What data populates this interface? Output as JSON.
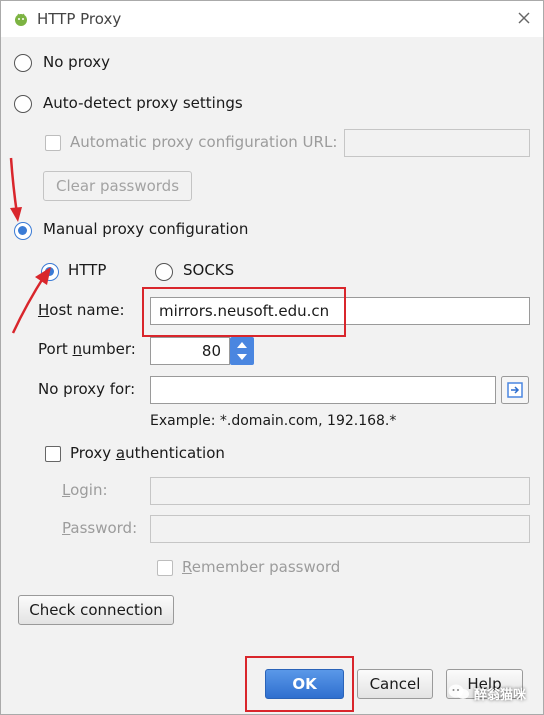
{
  "window": {
    "title": "HTTP Proxy",
    "close_icon": "close-icon",
    "app_icon": "android-studio-icon"
  },
  "options": {
    "no_proxy": "No proxy",
    "auto_detect": "Auto-detect proxy settings",
    "auto_config_url_label": "Automatic proxy configuration URL:",
    "auto_config_url_value": "",
    "clear_passwords": "Clear passwords",
    "manual": "Manual proxy configuration",
    "selected": "Manual proxy configuration"
  },
  "manual": {
    "protocol_http": "HTTP",
    "protocol_socks": "SOCKS",
    "selected_protocol": "HTTP",
    "host_label_prefix": "H",
    "host_label_rest": "ost name:",
    "host_value": "mirrors.neusoft.edu.cn",
    "port_label_prefix": "Port ",
    "port_label_ul": "n",
    "port_label_rest": "umber:",
    "port_value": "80",
    "no_proxy_label": "No proxy for:",
    "no_proxy_value": "",
    "example": "Example: *.domain.com, 192.168.*"
  },
  "auth": {
    "checkbox_prefix": "Proxy ",
    "checkbox_ul": "a",
    "checkbox_rest": "uthentication",
    "login_ul": "L",
    "login_rest": "ogin:",
    "login_value": "",
    "password_ul": "P",
    "password_rest": "assword:",
    "password_value": "",
    "remember_ul": "R",
    "remember_rest": "emember password"
  },
  "buttons": {
    "check_connection": "Check connection",
    "ok": "OK",
    "cancel": "Cancel",
    "help": "Help"
  },
  "watermark": {
    "text": "醉翁猫咪",
    "icon": "wechat-icon"
  },
  "colors": {
    "accent": "#3a7bd5",
    "annotation_red": "#d9262c"
  }
}
